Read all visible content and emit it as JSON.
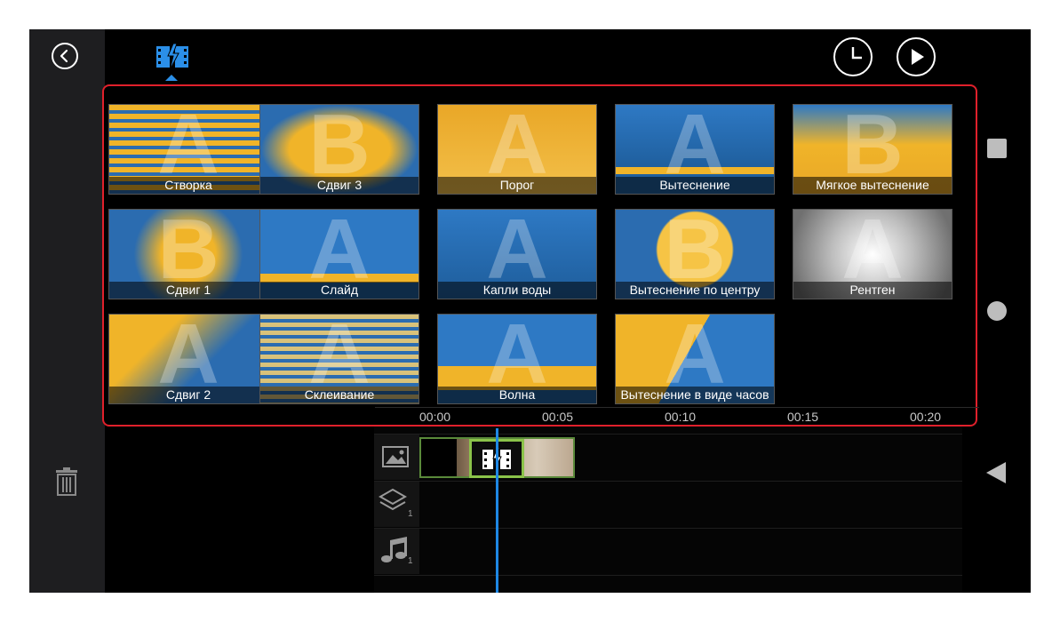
{
  "transitions": [
    {
      "name": "Створка",
      "letter": "A"
    },
    {
      "name": "Сдвиг 3",
      "letter": "B"
    },
    {
      "name": "Порог",
      "letter": "A"
    },
    {
      "name": "Вытеснение",
      "letter": "A"
    },
    {
      "name": "Мягкое вытеснение",
      "letter": "B"
    },
    {
      "name": "Сдвиг 1",
      "letter": "B"
    },
    {
      "name": "Слайд",
      "letter": "A"
    },
    {
      "name": "Капли воды",
      "letter": "A"
    },
    {
      "name": "Вытеснение по центру",
      "letter": "B"
    },
    {
      "name": "Рентген",
      "letter": "A"
    },
    {
      "name": "Сдвиг 2",
      "letter": "A"
    },
    {
      "name": "Склеивание",
      "letter": "A"
    },
    {
      "name": "Волна",
      "letter": "A"
    },
    {
      "name": "Вытеснение в виде часов",
      "letter": "A"
    }
  ],
  "timeline": {
    "ruler": [
      "00:00",
      "00:05",
      "00:10",
      "00:15",
      "00:20"
    ],
    "layers_count": "1",
    "audio_count": "1"
  },
  "icons": {
    "back": "chevron-left-icon",
    "transitions_tab": "film-transition-icon",
    "duration": "clock-icon",
    "play": "play-icon",
    "delete": "trash-icon"
  },
  "colors": {
    "accent": "#2b8fe8",
    "selection_border": "#e0202b",
    "clip_selected": "#8bc34a"
  }
}
